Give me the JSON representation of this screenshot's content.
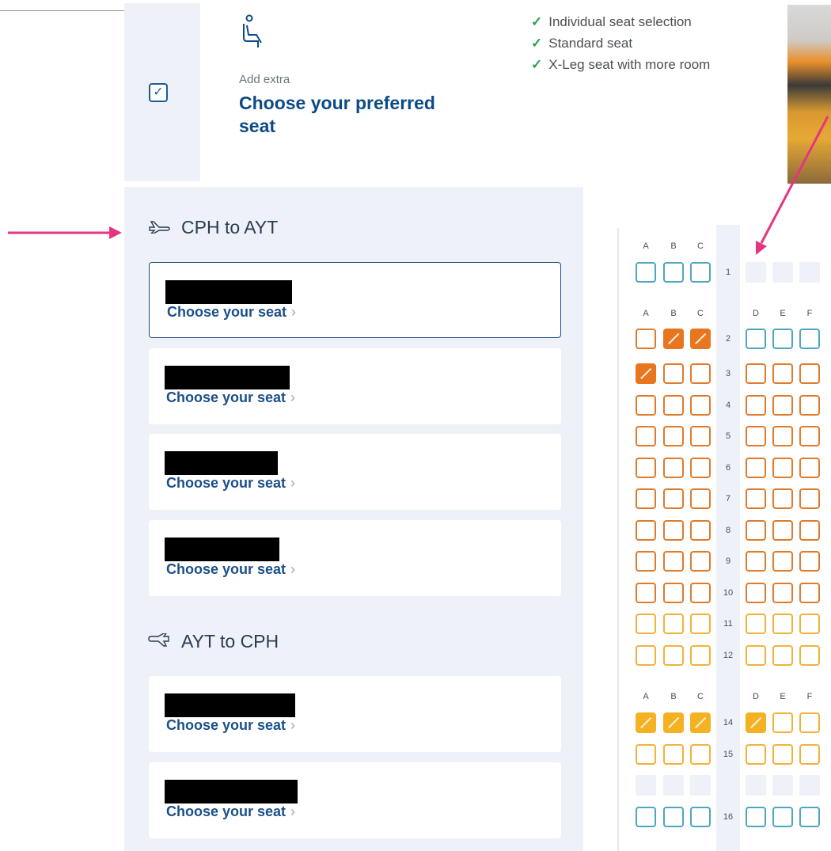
{
  "header": {
    "checkbox_mark": "✓",
    "add_extra_label": "Add extra",
    "title": "Choose your preferred seat",
    "benefits": [
      "Individual seat selection",
      "Standard seat",
      "X-Leg seat with more room"
    ],
    "benefit_tick": "✓"
  },
  "flights": [
    {
      "title": "CPH to AYT",
      "icon": "plane-takeoff-icon",
      "passengers": [
        {
          "link": "Choose your seat",
          "chevron": "›"
        },
        {
          "link": "Choose your seat",
          "chevron": "›"
        },
        {
          "link": "Choose your seat",
          "chevron": "›"
        },
        {
          "link": "Choose your seat",
          "chevron": "›"
        }
      ]
    },
    {
      "title": "AYT to CPH",
      "icon": "plane-landing-icon",
      "passengers": [
        {
          "link": "Choose your seat",
          "chevron": "›"
        },
        {
          "link": "Choose your seat",
          "chevron": "›"
        }
      ]
    }
  ],
  "seatmap": {
    "columns_left": [
      "A",
      "B",
      "C"
    ],
    "columns_right": [
      "D",
      "E",
      "F"
    ],
    "rows": [
      {
        "num": "1",
        "left": [
          "blue",
          "blue",
          "blue"
        ],
        "right": [
          "blank",
          "blank",
          "blank"
        ],
        "header": "left-only"
      },
      {
        "num": "2",
        "left": [
          "orange",
          "orange-taken",
          "orange-taken"
        ],
        "right": [
          "blue",
          "blue",
          "blue"
        ],
        "header": "both"
      },
      {
        "num": "3",
        "left": [
          "orange-taken",
          "orange",
          "orange"
        ],
        "right": [
          "orange",
          "orange",
          "orange"
        ]
      },
      {
        "num": "4",
        "left": [
          "orange",
          "orange",
          "orange"
        ],
        "right": [
          "orange",
          "orange",
          "orange"
        ]
      },
      {
        "num": "5",
        "left": [
          "orange",
          "orange",
          "orange"
        ],
        "right": [
          "orange",
          "orange",
          "orange"
        ]
      },
      {
        "num": "6",
        "left": [
          "orange",
          "orange",
          "orange"
        ],
        "right": [
          "orange",
          "orange",
          "orange"
        ]
      },
      {
        "num": "7",
        "left": [
          "orange",
          "orange",
          "orange"
        ],
        "right": [
          "orange",
          "orange",
          "orange"
        ]
      },
      {
        "num": "8",
        "left": [
          "orange",
          "orange",
          "orange"
        ],
        "right": [
          "orange",
          "orange",
          "orange"
        ]
      },
      {
        "num": "9",
        "left": [
          "orange",
          "orange",
          "orange"
        ],
        "right": [
          "orange",
          "orange",
          "orange"
        ]
      },
      {
        "num": "10",
        "left": [
          "orange",
          "orange",
          "orange"
        ],
        "right": [
          "orange",
          "orange",
          "orange"
        ]
      },
      {
        "num": "11",
        "left": [
          "yellow",
          "yellow",
          "yellow"
        ],
        "right": [
          "yellow",
          "yellow",
          "yellow"
        ]
      },
      {
        "num": "12",
        "left": [
          "yellow",
          "yellow",
          "yellow"
        ],
        "right": [
          "yellow",
          "yellow",
          "yellow"
        ]
      },
      {
        "num": "14",
        "left": [
          "yellow-taken",
          "yellow-taken",
          "yellow-taken"
        ],
        "right": [
          "yellow-taken",
          "yellow",
          "yellow"
        ],
        "header": "both"
      },
      {
        "num": "15",
        "left": [
          "yellow",
          "yellow",
          "yellow"
        ],
        "right": [
          "yellow",
          "yellow",
          "yellow"
        ]
      },
      {
        "num": "",
        "left": [
          "blank",
          "blank",
          "blank"
        ],
        "right": [
          "blank",
          "blank",
          "blank"
        ]
      },
      {
        "num": "16",
        "left": [
          "blue",
          "blue",
          "blue"
        ],
        "right": [
          "blue",
          "blue",
          "blue"
        ]
      }
    ]
  },
  "colors": {
    "annotation_arrow": "#e6357f",
    "brand": "#0b4a86"
  }
}
